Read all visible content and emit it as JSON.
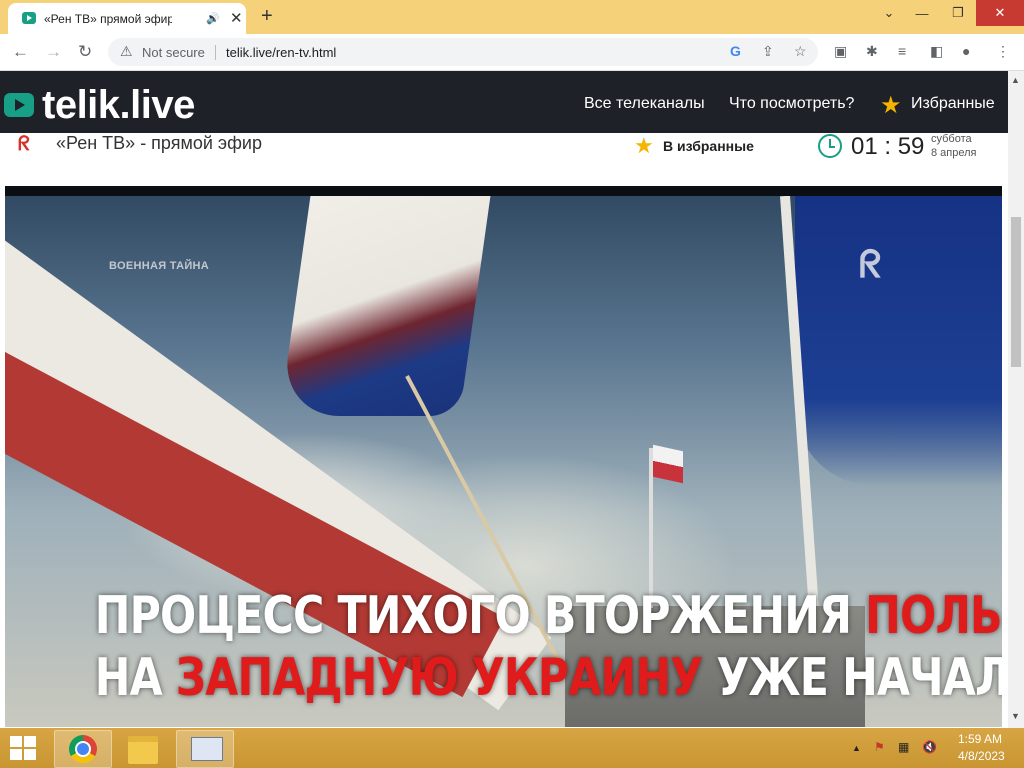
{
  "browser": {
    "tab_title": "«Рен ТВ» прямой эфир - см",
    "audio_icon": "speaker-icon",
    "close_glyph": "✕",
    "new_tab_glyph": "+",
    "window_controls": {
      "chevron": "⌄",
      "minimize": "—",
      "restore": "❐",
      "close": "✕"
    },
    "security_label": "Not secure",
    "url": "telik.live/ren-tv.html"
  },
  "site": {
    "logo": "telik.live",
    "nav": [
      "Все телеканалы",
      "Что посмотреть?",
      "Избранные"
    ],
    "channel_title": "«Рен ТВ» - прямой эфир",
    "favorite_label": "В избранные",
    "time": "01 : 59",
    "weekday": "суббота",
    "date": "8 апреля"
  },
  "video": {
    "watermark": "ВОЕННАЯ ТАЙНА",
    "subtitle_line1": {
      "white": "ПРОЦЕСС ТИХОГО ВТОРЖЕНИЯ ",
      "red": "ПОЛЬШИ"
    },
    "subtitle_line2": {
      "white1": "НА ",
      "red1": "ЗАПАДНУЮ УКРАИНУ",
      "white2": " УЖЕ НАЧАЛСЯ",
      "red2": "!"
    }
  },
  "taskbar": {
    "time": "1:59 AM",
    "date": "4/8/2023"
  },
  "colors": {
    "accent": "#17a085",
    "header_bg": "#1e2127",
    "star": "#f5b400",
    "titlebar": "#f5d27a",
    "taskbar": "#d7a543",
    "subtitle_red": "#e01b1b"
  }
}
